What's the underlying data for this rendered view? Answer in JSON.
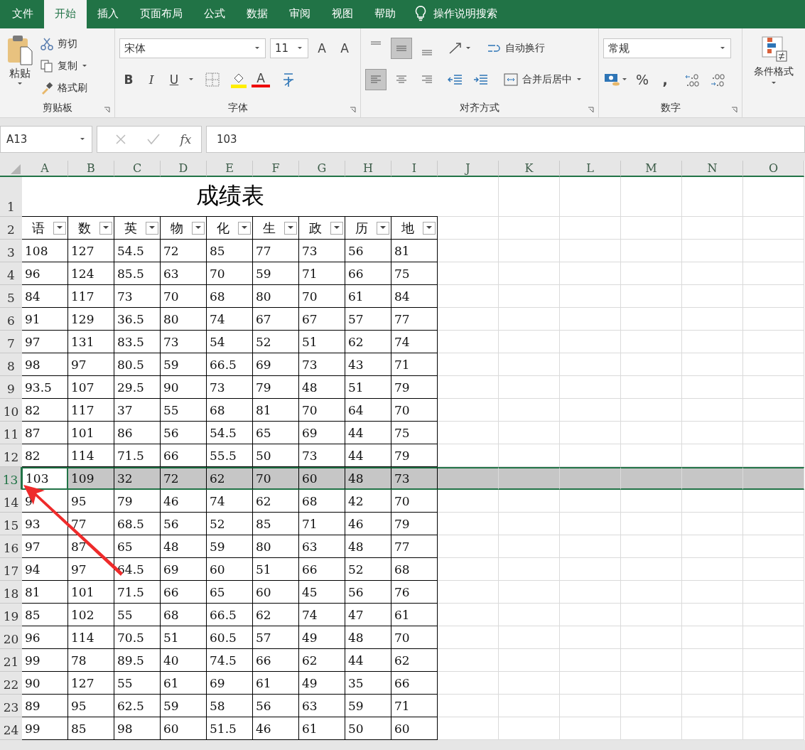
{
  "tabs": [
    {
      "label": "文件",
      "selected": false
    },
    {
      "label": "开始",
      "selected": true
    },
    {
      "label": "插入",
      "selected": false
    },
    {
      "label": "页面布局",
      "selected": false
    },
    {
      "label": "公式",
      "selected": false
    },
    {
      "label": "数据",
      "selected": false
    },
    {
      "label": "审阅",
      "selected": false
    },
    {
      "label": "视图",
      "selected": false
    },
    {
      "label": "帮助",
      "selected": false
    }
  ],
  "tell_me": "操作说明搜索",
  "ribbon": {
    "clipboard": {
      "paste": "粘贴",
      "cut": "剪切",
      "copy": "复制",
      "format_painter": "格式刷",
      "label": "剪贴板"
    },
    "font": {
      "font_name": "宋体",
      "font_size": "11",
      "grow": "A",
      "shrink": "A",
      "bold": "B",
      "italic": "I",
      "underline": "U",
      "font_color": "A",
      "label": "字体"
    },
    "alignment": {
      "vertical": [
        {
          "selected": false
        },
        {
          "selected": true
        },
        {
          "selected": false
        }
      ],
      "horizontal": [
        {
          "selected": true
        },
        {
          "selected": false
        },
        {
          "selected": false
        }
      ],
      "wrap_text": "自动换行",
      "merge_center": "合并后居中",
      "label": "对齐方式"
    },
    "number": {
      "format": "常规",
      "percent": "%",
      "comma": ",",
      "label": "数字"
    },
    "styles": {
      "conditional_format": "条件格式"
    }
  },
  "name_box": "A13",
  "function_label": "fx",
  "formula": "103",
  "columns": [
    "A",
    "B",
    "C",
    "D",
    "E",
    "F",
    "G",
    "H",
    "I",
    "J",
    "K",
    "L",
    "M",
    "N",
    "O"
  ],
  "rows": [
    {
      "number": "1",
      "kind": "title",
      "selected": false,
      "cells": [
        "成绩表"
      ]
    },
    {
      "number": "2",
      "kind": "header",
      "selected": false,
      "cells": [
        "语",
        "数",
        "英",
        "物",
        "化",
        "生",
        "政",
        "历",
        "地"
      ]
    },
    {
      "number": "3",
      "kind": "data",
      "selected": false,
      "cells": [
        "108",
        "127",
        "54.5",
        "72",
        "85",
        "77",
        "73",
        "56",
        "81"
      ]
    },
    {
      "number": "4",
      "kind": "data",
      "selected": false,
      "cells": [
        "96",
        "124",
        "85.5",
        "63",
        "70",
        "59",
        "71",
        "66",
        "75"
      ]
    },
    {
      "number": "5",
      "kind": "data",
      "selected": false,
      "cells": [
        "84",
        "117",
        "73",
        "70",
        "68",
        "80",
        "70",
        "61",
        "84"
      ]
    },
    {
      "number": "6",
      "kind": "data",
      "selected": false,
      "cells": [
        "91",
        "129",
        "36.5",
        "80",
        "74",
        "67",
        "67",
        "57",
        "77"
      ]
    },
    {
      "number": "7",
      "kind": "data",
      "selected": false,
      "cells": [
        "97",
        "131",
        "83.5",
        "73",
        "54",
        "52",
        "51",
        "62",
        "74"
      ]
    },
    {
      "number": "8",
      "kind": "data",
      "selected": false,
      "cells": [
        "98",
        "97",
        "80.5",
        "59",
        "66.5",
        "69",
        "73",
        "43",
        "71"
      ]
    },
    {
      "number": "9",
      "kind": "data",
      "selected": false,
      "cells": [
        "93.5",
        "107",
        "29.5",
        "90",
        "73",
        "79",
        "48",
        "51",
        "79"
      ]
    },
    {
      "number": "10",
      "kind": "data",
      "selected": false,
      "cells": [
        "82",
        "117",
        "37",
        "55",
        "68",
        "81",
        "70",
        "64",
        "70"
      ]
    },
    {
      "number": "11",
      "kind": "data",
      "selected": false,
      "cells": [
        "87",
        "101",
        "86",
        "56",
        "54.5",
        "65",
        "69",
        "44",
        "75"
      ]
    },
    {
      "number": "12",
      "kind": "data",
      "selected": false,
      "cells": [
        "82",
        "114",
        "71.5",
        "66",
        "55.5",
        "50",
        "73",
        "44",
        "79"
      ]
    },
    {
      "number": "13",
      "kind": "data",
      "selected": true,
      "cells": [
        "103",
        "109",
        "32",
        "72",
        "62",
        "70",
        "60",
        "48",
        "73"
      ]
    },
    {
      "number": "14",
      "kind": "data",
      "selected": false,
      "cells": [
        "9",
        "95",
        "79",
        "46",
        "74",
        "62",
        "68",
        "42",
        "70"
      ]
    },
    {
      "number": "15",
      "kind": "data",
      "selected": false,
      "cells": [
        "93",
        "77",
        "68.5",
        "56",
        "52",
        "85",
        "71",
        "46",
        "79"
      ]
    },
    {
      "number": "16",
      "kind": "data",
      "selected": false,
      "cells": [
        "97",
        "87",
        "65",
        "48",
        "59",
        "80",
        "63",
        "48",
        "77"
      ]
    },
    {
      "number": "17",
      "kind": "data",
      "selected": false,
      "cells": [
        "94",
        "97",
        "64.5",
        "69",
        "60",
        "51",
        "66",
        "52",
        "68"
      ]
    },
    {
      "number": "18",
      "kind": "data",
      "selected": false,
      "cells": [
        "81",
        "101",
        "71.5",
        "66",
        "65",
        "60",
        "45",
        "56",
        "76"
      ]
    },
    {
      "number": "19",
      "kind": "data",
      "selected": false,
      "cells": [
        "85",
        "102",
        "55",
        "68",
        "66.5",
        "62",
        "74",
        "47",
        "61"
      ]
    },
    {
      "number": "20",
      "kind": "data",
      "selected": false,
      "cells": [
        "96",
        "114",
        "70.5",
        "51",
        "60.5",
        "57",
        "49",
        "48",
        "70"
      ]
    },
    {
      "number": "21",
      "kind": "data",
      "selected": false,
      "cells": [
        "99",
        "78",
        "89.5",
        "40",
        "74.5",
        "66",
        "62",
        "44",
        "62"
      ]
    },
    {
      "number": "22",
      "kind": "data",
      "selected": false,
      "cells": [
        "90",
        "127",
        "55",
        "61",
        "69",
        "61",
        "49",
        "35",
        "66"
      ]
    },
    {
      "number": "23",
      "kind": "data",
      "selected": false,
      "cells": [
        "89",
        "95",
        "62.5",
        "59",
        "58",
        "56",
        "63",
        "59",
        "71"
      ]
    },
    {
      "number": "24",
      "kind": "data",
      "selected": false,
      "cells": [
        "99",
        "85",
        "98",
        "60",
        "51.5",
        "46",
        "61",
        "50",
        "60"
      ]
    }
  ]
}
